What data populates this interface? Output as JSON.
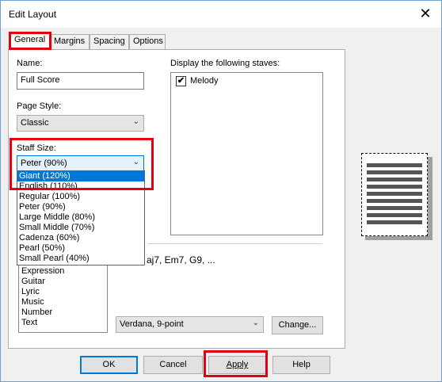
{
  "window": {
    "title": "Edit Layout",
    "close_glyph": "✕"
  },
  "tabs": [
    {
      "label": "General"
    },
    {
      "label": "Margins"
    },
    {
      "label": "Spacing"
    },
    {
      "label": "Options"
    }
  ],
  "general": {
    "name_label": "Name:",
    "name_value": "Full Score",
    "page_style_label": "Page Style:",
    "page_style_value": "Classic",
    "staff_size_label": "Staff Size:",
    "staff_size_value": "Peter (90%)",
    "staff_size_options": [
      "Giant (120%)",
      "English (110%)",
      "Regular (100%)",
      "Peter (90%)",
      "Large Middle (80%)",
      "Small Middle (70%)",
      "Cadenza (60%)",
      "Pearl (50%)",
      "Small Pearl (40%)"
    ],
    "highlighted_option_index": 0,
    "staves_label": "Display the following staves:",
    "staves": [
      {
        "label": "Melody",
        "checked": true,
        "check_glyph": "✔"
      }
    ],
    "text_styles": [
      "Expression",
      "Guitar",
      "Lyric",
      "Music",
      "Number",
      "Text"
    ],
    "chord_preview": "aj7, Em7, G9, ...",
    "font_value": "Verdana, 9-point",
    "change_button": "Change..."
  },
  "buttons": {
    "ok": "OK",
    "cancel": "Cancel",
    "apply": "Apply",
    "help": "Help"
  },
  "colors": {
    "highlight_red": "#e3000f",
    "selection_blue": "#0078d7"
  }
}
